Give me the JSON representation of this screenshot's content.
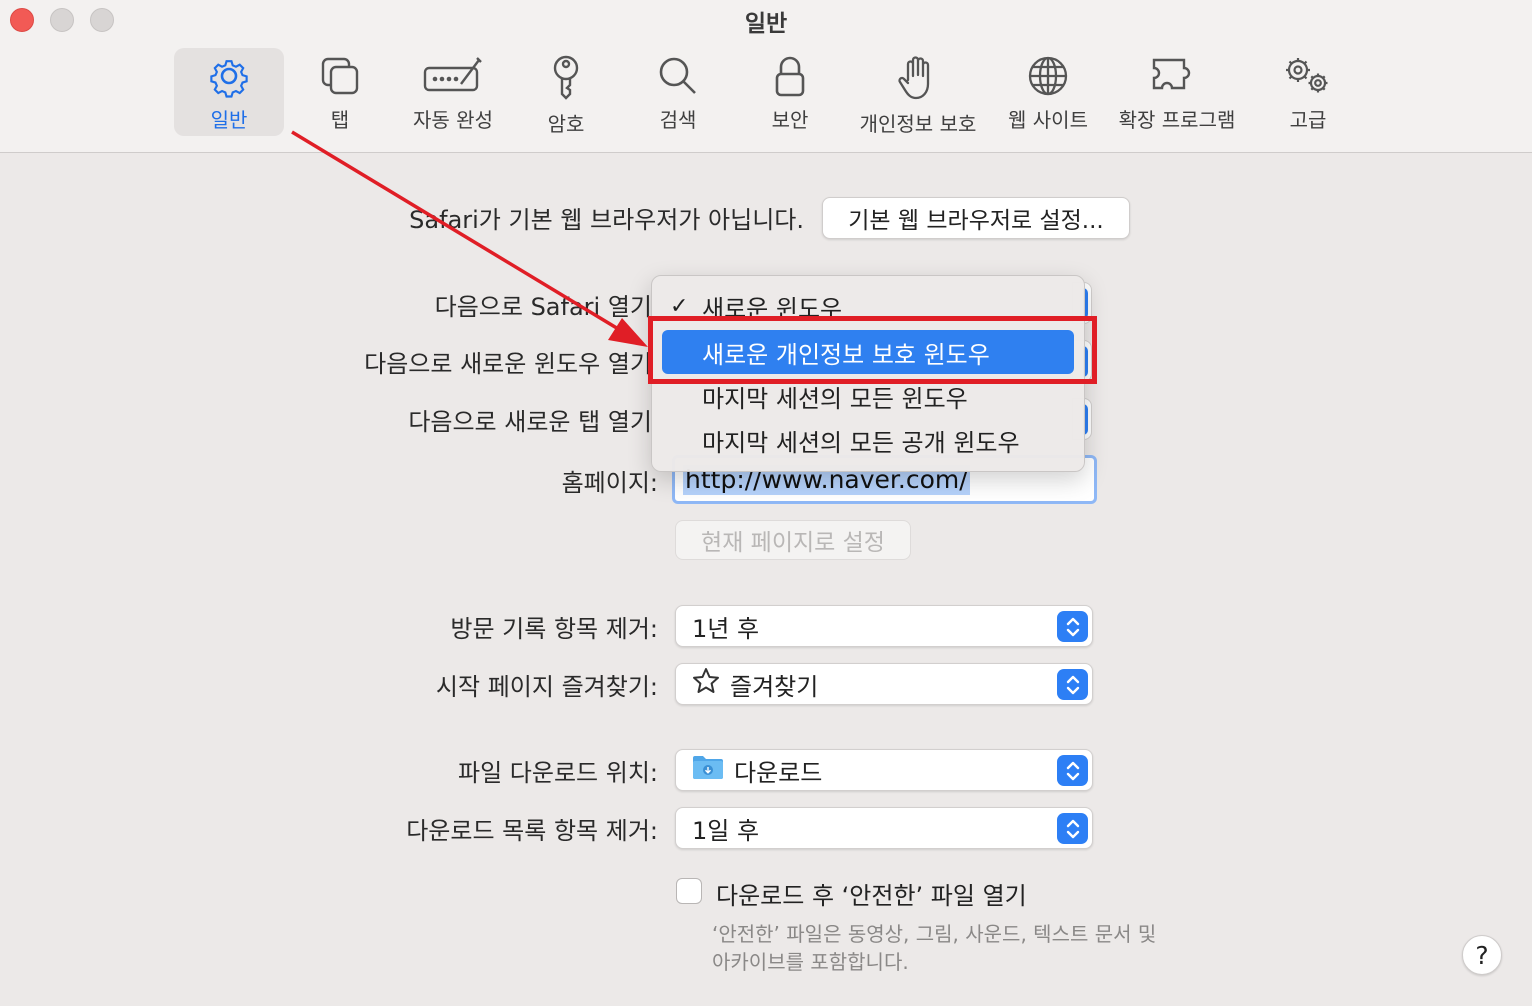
{
  "window": {
    "title": "일반"
  },
  "toolbar": {
    "tabs": [
      {
        "label": "일반",
        "icon": "gear-icon",
        "selected": true
      },
      {
        "label": "탭",
        "icon": "tabs-icon"
      },
      {
        "label": "자동 완성",
        "icon": "autofill-icon"
      },
      {
        "label": "암호",
        "icon": "key-icon"
      },
      {
        "label": "검색",
        "icon": "search-icon"
      },
      {
        "label": "보안",
        "icon": "lock-icon"
      },
      {
        "label": "개인정보 보호",
        "icon": "hand-icon"
      },
      {
        "label": "웹 사이트",
        "icon": "globe-icon"
      },
      {
        "label": "확장 프로그램",
        "icon": "puzzle-icon"
      },
      {
        "label": "고급",
        "icon": "gears-icon"
      }
    ]
  },
  "default_browser": {
    "message": "Safari가 기본 웹 브라우저가 아닙니다.",
    "button": "기본 웹 브라우저로 설정..."
  },
  "labels": {
    "open_with": "다음으로 Safari 열기",
    "new_window": "다음으로 새로운 윈도우 열기",
    "new_tab": "다음으로 새로운 탭 열기",
    "homepage": "홈페이지:",
    "remove_history": "방문 기록 항목 제거:",
    "favorites": "시작 페이지 즐겨찾기:",
    "download_location": "파일 다운로드 위치:",
    "remove_downloads": "다운로드 목록 항목 제거:"
  },
  "homepage": {
    "value": "http://www.naver.com/",
    "set_current": "현재 페이지로 설정"
  },
  "popups": {
    "remove_history": "1년 후",
    "favorites": "즐겨찾기",
    "download_location": "다운로드",
    "remove_downloads": "1일 후"
  },
  "safe_files": {
    "label": "다운로드 후 ‘안전한’ 파일 열기",
    "checked": false,
    "note_line1": "‘안전한’ 파일은 동영상, 그림, 사운드, 텍스트 문서 및",
    "note_line2": "아카이브를 포함합니다."
  },
  "menu": {
    "items": [
      {
        "label": "새로운 윈도우",
        "checked": true
      },
      {
        "label": "새로운 개인정보 보호 윈도우",
        "highlighted": true
      },
      {
        "label": "마지막 세션의 모든 윈도우"
      },
      {
        "label": "마지막 세션의 모든 공개 윈도우"
      }
    ],
    "check_mark": "✓"
  },
  "help": {
    "label": "?"
  },
  "colors": {
    "accent": "#2d7ff5",
    "annotation": "#e01e26",
    "selected_tab_text": "#1f6fe8"
  }
}
